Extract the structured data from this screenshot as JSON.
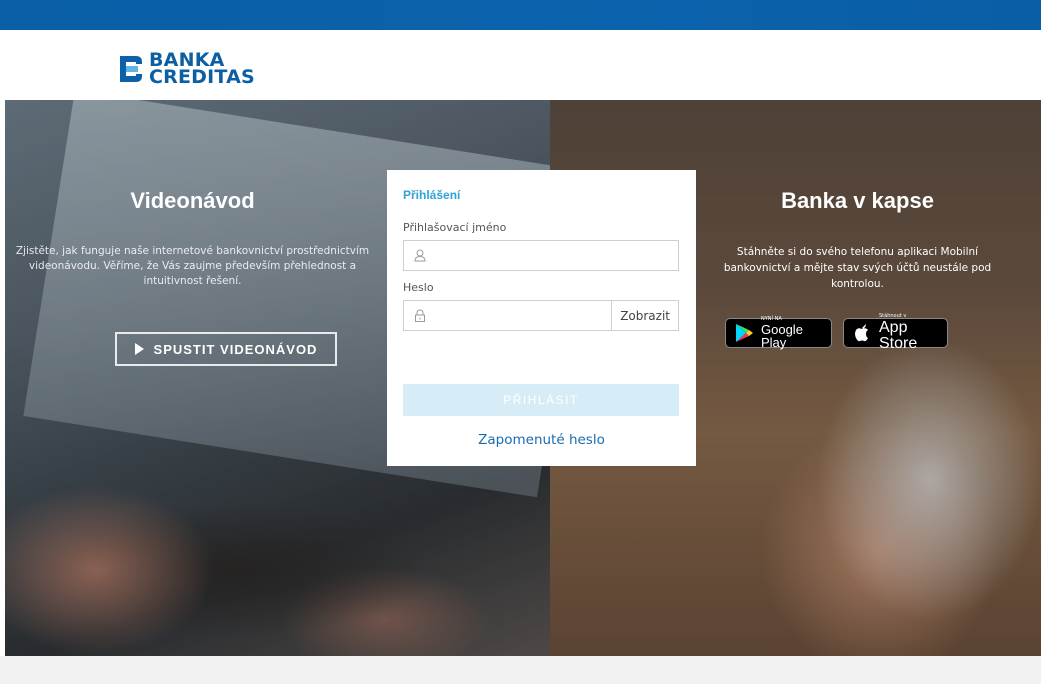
{
  "brand": {
    "name_line1": "BANKA",
    "name_line2": "CREDITAS",
    "primary_color": "#0b62ab"
  },
  "promo_video": {
    "title": "Videonávod",
    "text": "Zjistěte, jak funguje naše internetové bankovnictví prostřednictvím videonávodu. Věříme, že Vás zaujme především přehlednost a intuitivnost řešení.",
    "button_label": "SPUSTIT VIDEONÁVOD"
  },
  "login": {
    "title": "Přihlášení",
    "username_label": "Přihlašovací jméno",
    "username_value": "",
    "password_label": "Heslo",
    "password_value": "",
    "show_label": "Zobrazit",
    "submit_label": "PŘIHLÁSIT",
    "forgot_label": "Zapomenuté heslo",
    "accent_color": "#2fa3d6"
  },
  "promo_mobile": {
    "title": "Banka v kapse",
    "text": "Stáhněte si do svého telefonu aplikaci Mobilní bankovnictví a mějte stav svých účtů neustále pod kontrolou.",
    "google_small": "NYNÍ NA",
    "google_big": "Google Play",
    "apple_small": "Stáhnout v",
    "apple_big": "App Store"
  }
}
